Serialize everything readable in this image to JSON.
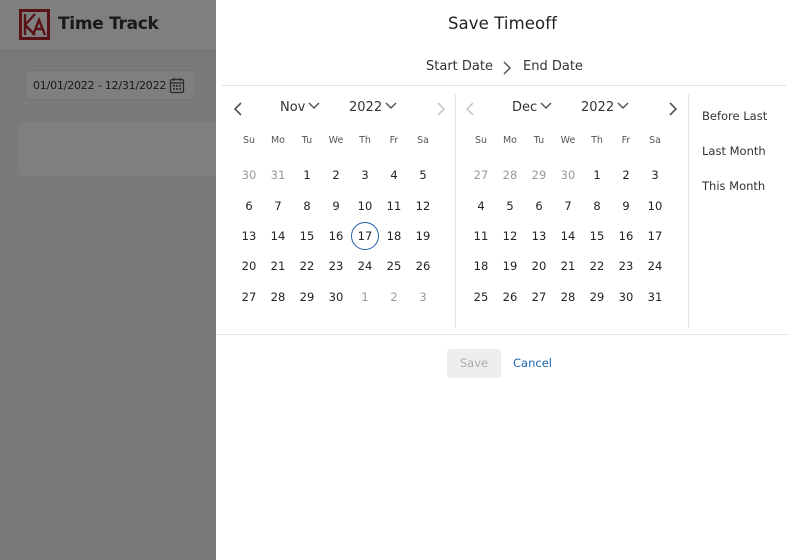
{
  "app": {
    "title": "Time Track",
    "date_range_value": "01/01/2022 - 12/31/2022",
    "brand_color": "#b3262c"
  },
  "drawer": {
    "title": "Save Timeoff",
    "steps": {
      "start": "Start Date",
      "end": "End Date"
    },
    "weekdays": [
      "Su",
      "Mo",
      "Tu",
      "We",
      "Th",
      "Fr",
      "Sa"
    ],
    "calendars": [
      {
        "month": "Nov",
        "year": "2022",
        "prev_enabled": true,
        "next_enabled": false,
        "weeks": [
          [
            "30",
            "31",
            "1",
            "2",
            "3",
            "4",
            "5"
          ],
          [
            "6",
            "7",
            "8",
            "9",
            "10",
            "11",
            "12"
          ],
          [
            "13",
            "14",
            "15",
            "16",
            "17",
            "18",
            "19"
          ],
          [
            "20",
            "21",
            "22",
            "23",
            "24",
            "25",
            "26"
          ],
          [
            "27",
            "28",
            "29",
            "30",
            "1",
            "2",
            "3"
          ]
        ],
        "muted": [
          [
            0,
            0
          ],
          [
            0,
            1
          ],
          [
            4,
            4
          ],
          [
            4,
            5
          ],
          [
            4,
            6
          ]
        ],
        "today": [
          2,
          4
        ]
      },
      {
        "month": "Dec",
        "year": "2022",
        "prev_enabled": false,
        "next_enabled": true,
        "weeks": [
          [
            "27",
            "28",
            "29",
            "30",
            "1",
            "2",
            "3"
          ],
          [
            "4",
            "5",
            "6",
            "7",
            "8",
            "9",
            "10"
          ],
          [
            "11",
            "12",
            "13",
            "14",
            "15",
            "16",
            "17"
          ],
          [
            "18",
            "19",
            "20",
            "21",
            "22",
            "23",
            "24"
          ],
          [
            "25",
            "26",
            "27",
            "28",
            "29",
            "30",
            "31"
          ]
        ],
        "muted": [
          [
            0,
            0
          ],
          [
            0,
            1
          ],
          [
            0,
            2
          ],
          [
            0,
            3
          ]
        ],
        "today": null
      }
    ],
    "presets": [
      "Before Last",
      "Last Month",
      "This Month"
    ],
    "save_label": "Save",
    "cancel_label": "Cancel",
    "accent_color": "#1e66b0"
  }
}
